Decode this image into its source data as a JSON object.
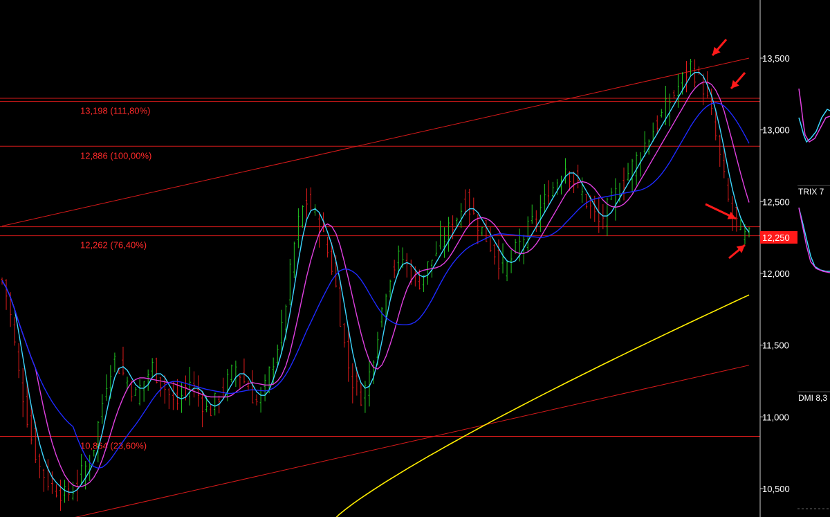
{
  "chart_data": {
    "type": "candlestick",
    "y_axis": {
      "ticks": [
        "13,500",
        "13,000",
        "12,500",
        "12,000",
        "11,500",
        "11,000",
        "10,500"
      ],
      "tick_values": [
        13500,
        13000,
        12500,
        12000,
        11500,
        11000,
        10500
      ],
      "ylim": [
        10300,
        13900
      ],
      "gridlines": false,
      "position": "right"
    },
    "current_price": {
      "label": "12,250",
      "value": 12250,
      "color": "#ff1a1a"
    },
    "fib_levels": [
      {
        "label": "13,198 (111,80%)",
        "value": 13198
      },
      {
        "label": "12,886 (100,00%)",
        "value": 12886
      },
      {
        "label": "12,262 (76,40%)",
        "value": 12262
      },
      {
        "label": "10,864 (23,60%)",
        "value": 10864
      }
    ],
    "extra_hlines": [
      13220,
      12325
    ],
    "trendlines": [
      {
        "from": [
          0,
          12330
        ],
        "to": [
          225,
          13500
        ]
      },
      {
        "from": [
          22,
          10300
        ],
        "to": [
          225,
          11360
        ]
      }
    ],
    "bars_count": 226,
    "candles_approx_close": [
      11950,
      11850,
      11700,
      11500,
      11300,
      11150,
      11000,
      10850,
      10750,
      10650,
      10600,
      10550,
      10520,
      10500,
      10480,
      10450,
      10470,
      10500,
      10550,
      10600,
      10650,
      10700,
      10800,
      10950,
      11100,
      11250,
      11350,
      11400,
      11350,
      11300,
      11250,
      11200,
      11150,
      11200,
      11250,
      11300,
      11350,
      11300,
      11250,
      11200,
      11150,
      11100,
      11100,
      11150,
      11200,
      11250,
      11200,
      11150,
      11100,
      11050,
      11050,
      11100,
      11150,
      11200,
      11250,
      11300,
      11350,
      11300,
      11250,
      11200,
      11150,
      11100,
      11150,
      11200,
      11300,
      11400,
      11500,
      11600,
      11800,
      12000,
      12200,
      12350,
      12450,
      12500,
      12450,
      12400,
      12350,
      12250,
      12150,
      12050,
      11900,
      11700,
      11500,
      11350,
      11250,
      11200,
      11150,
      11200,
      11300,
      11450,
      11600,
      11750,
      11900,
      12000,
      12050,
      12100,
      12100,
      12050,
      12000,
      11950,
      11950,
      12000,
      12050,
      12100,
      12150,
      12200,
      12250,
      12300,
      12350,
      12400,
      12450,
      12500,
      12450,
      12400,
      12350,
      12300,
      12250,
      12200,
      12150,
      12100,
      12050,
      12050,
      12100,
      12150,
      12200,
      12250,
      12300,
      12350,
      12400,
      12450,
      12500,
      12550,
      12600,
      12650,
      12700,
      12750,
      12700,
      12650,
      12600,
      12550,
      12500,
      12450,
      12400,
      12350,
      12400,
      12450,
      12500,
      12550,
      12600,
      12650,
      12700,
      12750,
      12800,
      12850,
      12900,
      12950,
      13000,
      13050,
      13100,
      13150,
      13200,
      13250,
      13300,
      13350,
      13400,
      13450,
      13400,
      13350,
      13300,
      13200,
      13100,
      12950,
      12800,
      12650,
      12500,
      12400,
      12350,
      12300,
      12250,
      12250
    ],
    "moving_averages": [
      {
        "color": "#3cd6ff",
        "period": "fast"
      },
      {
        "color": "#e040e0",
        "period": "medium"
      },
      {
        "color": "#1e2aff",
        "period": "slow"
      },
      {
        "color": "#ffee00",
        "period": "long"
      }
    ],
    "annotations": [
      "red-arrow",
      "red-arrow",
      "red-arrow",
      "red-arrow"
    ]
  },
  "right_panels": [
    {
      "label": "TRIX 7"
    },
    {
      "label": "DMI 8,3"
    }
  ],
  "colors": {
    "background": "#000000",
    "up": "#22c722",
    "down": "#e01b1b",
    "fib": "#d61a1a",
    "trend": "#d61a1a"
  }
}
